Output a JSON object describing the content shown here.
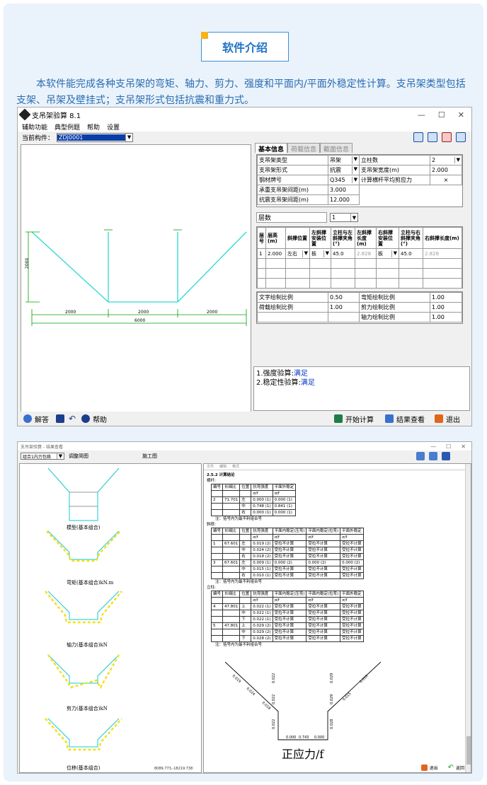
{
  "heading": "软件介绍",
  "intro": "本软件能完成各种支吊架的弯矩、轴力、剪力、强度和平面内/平面外稳定性计算。支吊架类型包括支架、吊架及壁挂式；支吊架形式包括抗震和重力式。",
  "win1": {
    "title": "支吊架验算 8.1",
    "controls": [
      "—",
      "☐",
      "✕"
    ],
    "menu": [
      "辅助功能",
      "典型例题",
      "帮助",
      "设置"
    ],
    "current_label": "当前构件：",
    "current_value": "ZDJ0001",
    "tabs": [
      "基本信息",
      "荷载信息",
      "截面信息"
    ],
    "basic": [
      [
        "支吊架类型",
        "吊架",
        "立柱数",
        "2"
      ],
      [
        "支吊架形式",
        "抗震",
        "支吊架宽度(m)",
        "2.000"
      ],
      [
        "钢材牌号",
        "Q345",
        "计算横杆平均剪应力",
        "×"
      ],
      [
        "承重支吊架间距(m)",
        "3.000",
        "",
        ""
      ],
      [
        "抗震支吊架间距(m)",
        "12.000",
        "",
        ""
      ]
    ],
    "layers_label": "层数",
    "layers_value": "1",
    "layer_headers": [
      "层号",
      "层高(m)",
      "斜撑位置",
      "左斜撑安装位置",
      "立柱与左斜撑夹角(°)",
      "左斜撑长度(m)",
      "右斜撑安装位置",
      "立柱与右斜撑夹角(°)",
      "右斜撑长度(m)"
    ],
    "layer_row": [
      "1",
      "2.000",
      "左右",
      "板",
      "45.0",
      "2.828",
      "板",
      "45.0",
      "2.828"
    ],
    "scales": [
      [
        "文字绘制比例",
        "0.50",
        "弯矩绘制比例",
        "1.00"
      ],
      [
        "荷载绘制比例",
        "1.00",
        "剪力绘制比例",
        "1.00"
      ],
      [
        "",
        "",
        "轴力绘制比例",
        "1.00"
      ]
    ],
    "results": [
      {
        "text": "1.强度验算:",
        "status": "满足"
      },
      {
        "text": "2.稳定性验算:",
        "status": "满足"
      }
    ],
    "drawing": {
      "height": "2000",
      "w_left": "2000",
      "w_mid": "2000",
      "w_right": "2000",
      "total": "6000"
    },
    "bottom": {
      "help_note": "解答",
      "help": "帮助",
      "calc": "开始计算",
      "view": "结果查看",
      "exit": "退出"
    }
  },
  "win2": {
    "title": "支吊架验算 - 结果查看",
    "combo": "组合1内力包络",
    "btn_adjust": "调整简图",
    "btn_draw": "施工图",
    "menu": [
      "文件",
      "编辑",
      "格式"
    ],
    "labels": [
      "模型(基本组合)",
      "弯矩(基本组合)kN.m",
      "轴力(基本组合)kN",
      "剪力(基本组合)kN",
      "位移(基本组合)"
    ],
    "coords": "8089.773,-18219.738",
    "section_title": "2.5.2 计算结论",
    "doc_lines": [
      "横杆:",
      "注：括号内为最不利组合号",
      "斜撑:",
      "注：括号内为最不利组合号",
      "立柱:",
      "注：括号内为最不利组合号"
    ],
    "stress_label": "正应力/f",
    "exit": "退出",
    "back": "返回",
    "diagram_values": [
      "0.019",
      "0.024",
      "0.018",
      "0.022",
      "0.022",
      "0.022",
      "0.029",
      "0.029",
      "0.028",
      "0.015",
      "0.010",
      "0.000",
      "0.743",
      "0.000"
    ]
  }
}
